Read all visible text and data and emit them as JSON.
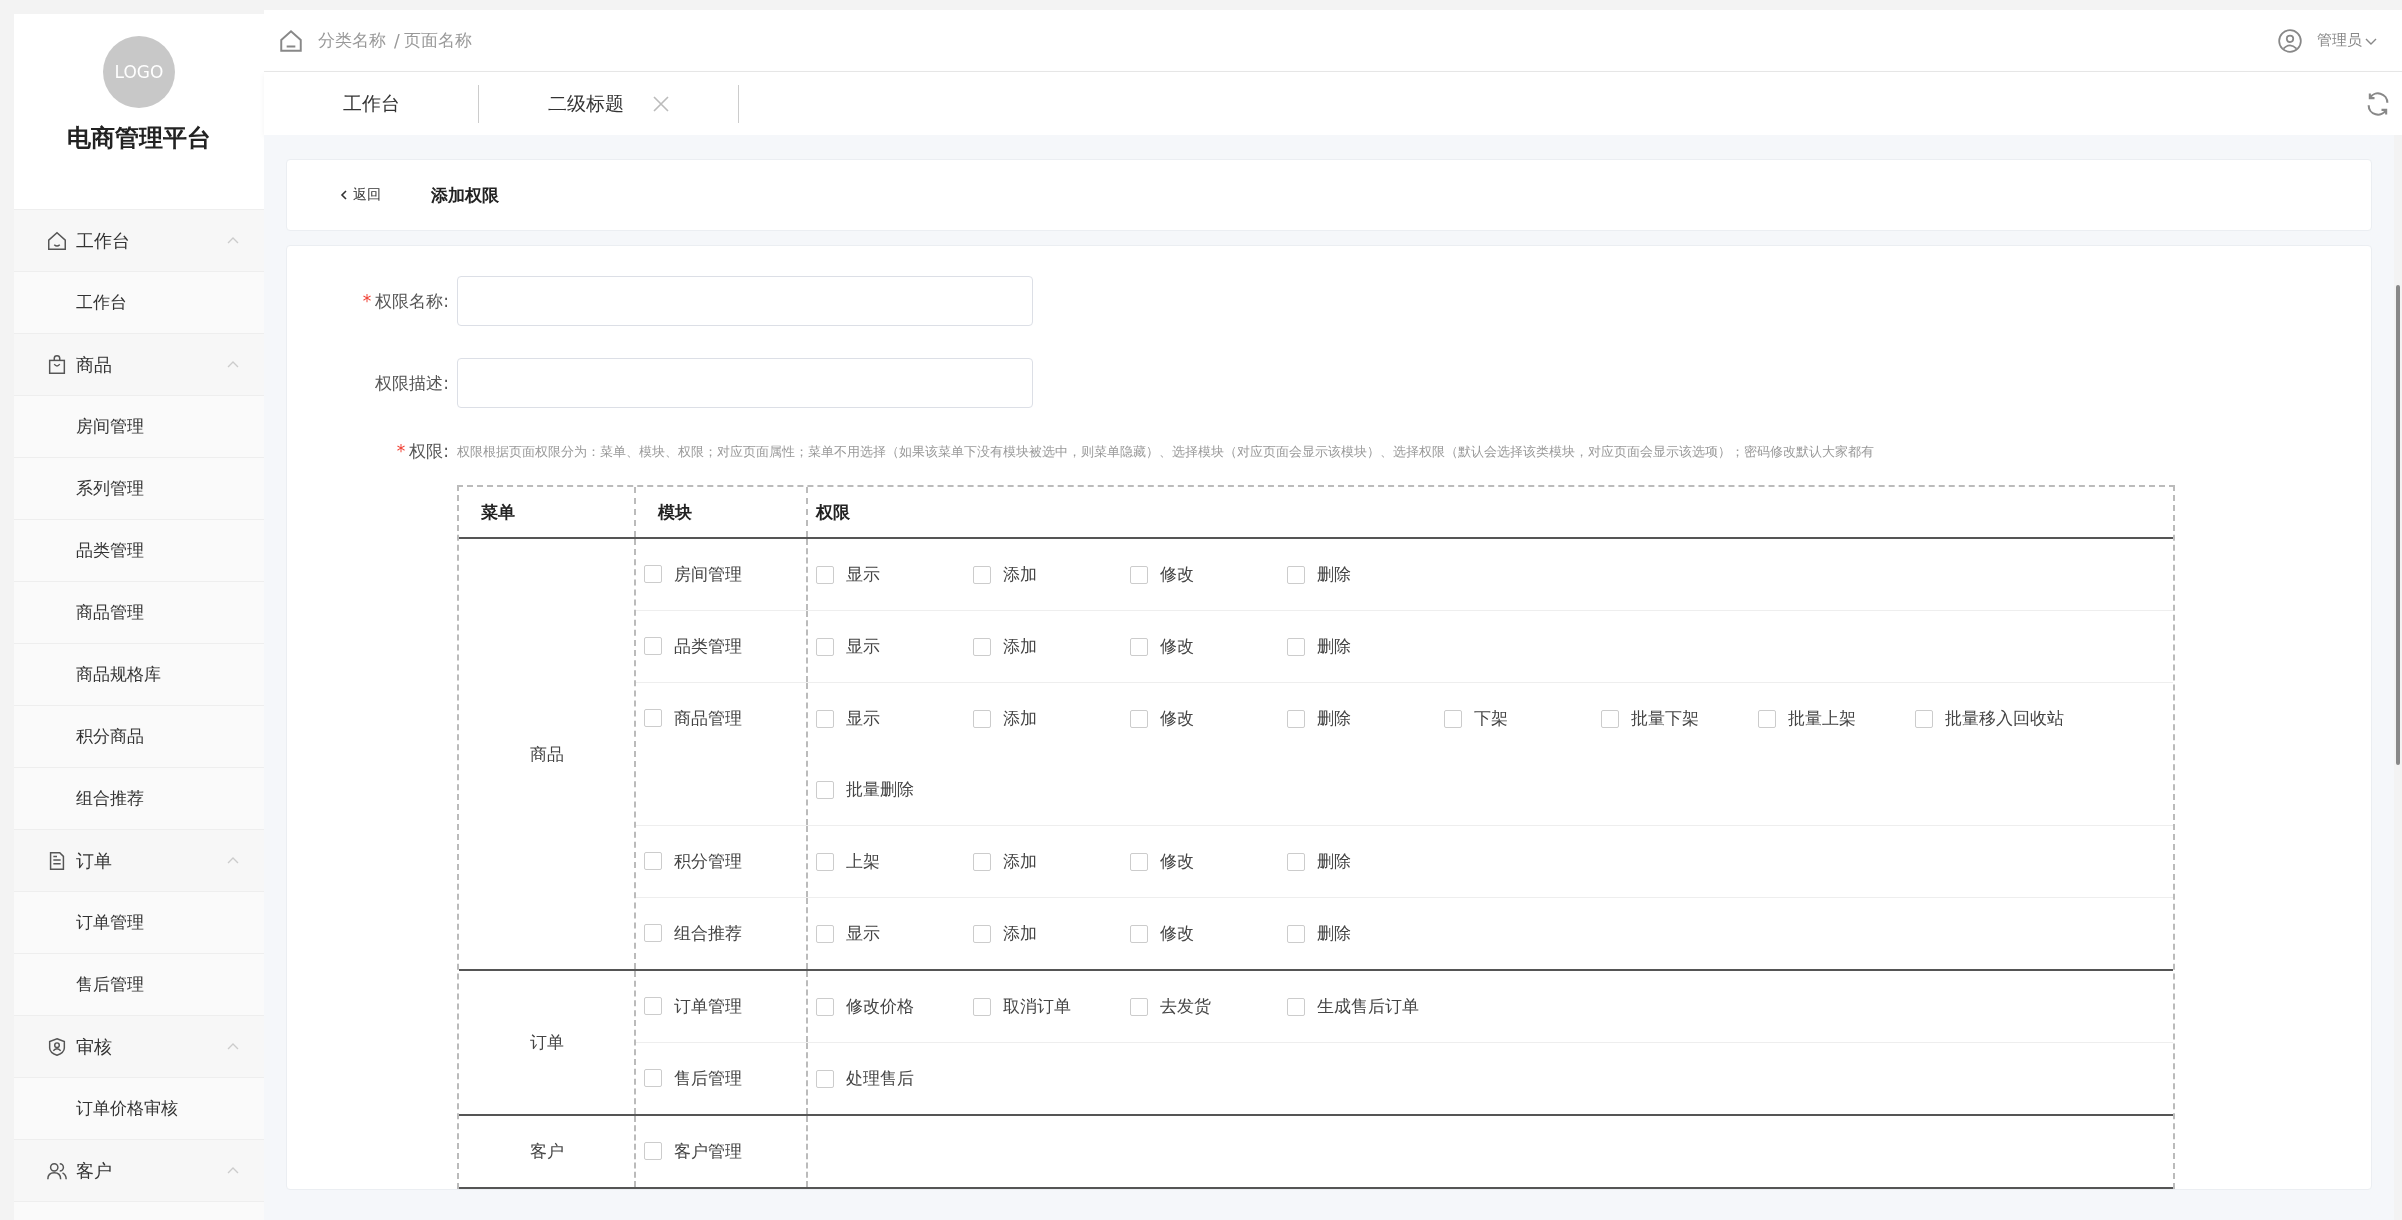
{
  "sidebar": {
    "logo": "LOGO",
    "title": "电商管理平台",
    "groups": [
      {
        "label": "工作台",
        "expanded": true,
        "items": [
          "工作台"
        ]
      },
      {
        "label": "商品",
        "expanded": true,
        "items": [
          "房间管理",
          "系列管理",
          "品类管理",
          "商品管理",
          "商品规格库",
          "积分商品",
          "组合推荐"
        ]
      },
      {
        "label": "订单",
        "expanded": true,
        "items": [
          "订单管理",
          "售后管理"
        ]
      },
      {
        "label": "审核",
        "expanded": true,
        "items": [
          "订单价格审核"
        ]
      },
      {
        "label": "客户",
        "expanded": true
      }
    ]
  },
  "breadcrumb": {
    "category": "分类名称",
    "separator": "/",
    "page": "页面名称"
  },
  "user": {
    "name": "管理员"
  },
  "tabs": [
    {
      "label": "工作台",
      "closable": false
    },
    {
      "label": "二级标题",
      "closable": true
    }
  ],
  "page_header": {
    "back": "返回",
    "title": "添加权限"
  },
  "form": {
    "fields": [
      {
        "label": "权限名称:",
        "mark": "*"
      },
      {
        "label": "权限描述:"
      }
    ],
    "permissions": {
      "label": "权限:",
      "mark": "*",
      "hint": "权限根据页面权限分为：菜单、模块、权限；对应页面属性；菜单不用选择（如果该菜单下没有模块被选中，则菜单隐藏）、选择模块（对应页面会显示该模块）、选择权限（默认会选择该类模块，对应页面会显示该选项）；密码修改默认大家都有",
      "columns": [
        "菜单",
        "模块",
        "权限"
      ],
      "groups": [
        {
          "menu": "商品",
          "modules": [
            {
              "name": "房间管理",
              "checked": false,
              "perms": [
                {
                  "label": "显示",
                  "checked": false
                },
                {
                  "label": "添加",
                  "checked": false
                },
                {
                  "label": "修改",
                  "checked": false
                },
                {
                  "label": "删除",
                  "checked": false
                }
              ]
            },
            {
              "name": "品类管理",
              "checked": false,
              "perms": [
                {
                  "label": "显示",
                  "checked": false
                },
                {
                  "label": "添加",
                  "checked": false
                },
                {
                  "label": "修改",
                  "checked": false
                },
                {
                  "label": "删除",
                  "checked": false
                }
              ]
            },
            {
              "name": "商品管理",
              "checked": false,
              "perms": [
                {
                  "label": "显示",
                  "checked": false
                },
                {
                  "label": "添加",
                  "checked": false
                },
                {
                  "label": "修改",
                  "checked": false
                },
                {
                  "label": "删除",
                  "checked": false
                },
                {
                  "label": "下架",
                  "checked": false
                },
                {
                  "label": "批量下架",
                  "checked": false
                },
                {
                  "label": "批量上架",
                  "checked": false
                },
                {
                  "label": "批量移入回收站",
                  "checked": false
                },
                {
                  "label": "批量删除",
                  "checked": false
                }
              ]
            },
            {
              "name": "积分管理",
              "checked": false,
              "perms": [
                {
                  "label": "上架",
                  "checked": false
                },
                {
                  "label": "添加",
                  "checked": false
                },
                {
                  "label": "修改",
                  "checked": false
                },
                {
                  "label": "删除",
                  "checked": false
                }
              ]
            },
            {
              "name": "组合推荐",
              "checked": false,
              "perms": [
                {
                  "label": "显示",
                  "checked": false
                },
                {
                  "label": "添加",
                  "checked": false
                },
                {
                  "label": "修改",
                  "checked": false
                },
                {
                  "label": "删除",
                  "checked": false
                }
              ]
            }
          ]
        },
        {
          "menu": "订单",
          "modules": [
            {
              "name": "订单管理",
              "checked": false,
              "perms": [
                {
                  "label": "修改价格",
                  "checked": false
                },
                {
                  "label": "取消订单",
                  "checked": false
                },
                {
                  "label": "去发货",
                  "checked": false
                },
                {
                  "label": "生成售后订单",
                  "checked": false
                }
              ]
            },
            {
              "name": "售后管理",
              "checked": false,
              "perms": [
                {
                  "label": "处理售后",
                  "checked": false
                }
              ]
            }
          ]
        },
        {
          "menu": "客户",
          "modules": [
            {
              "name": "客户管理",
              "checked": false
            }
          ]
        }
      ]
    }
  }
}
